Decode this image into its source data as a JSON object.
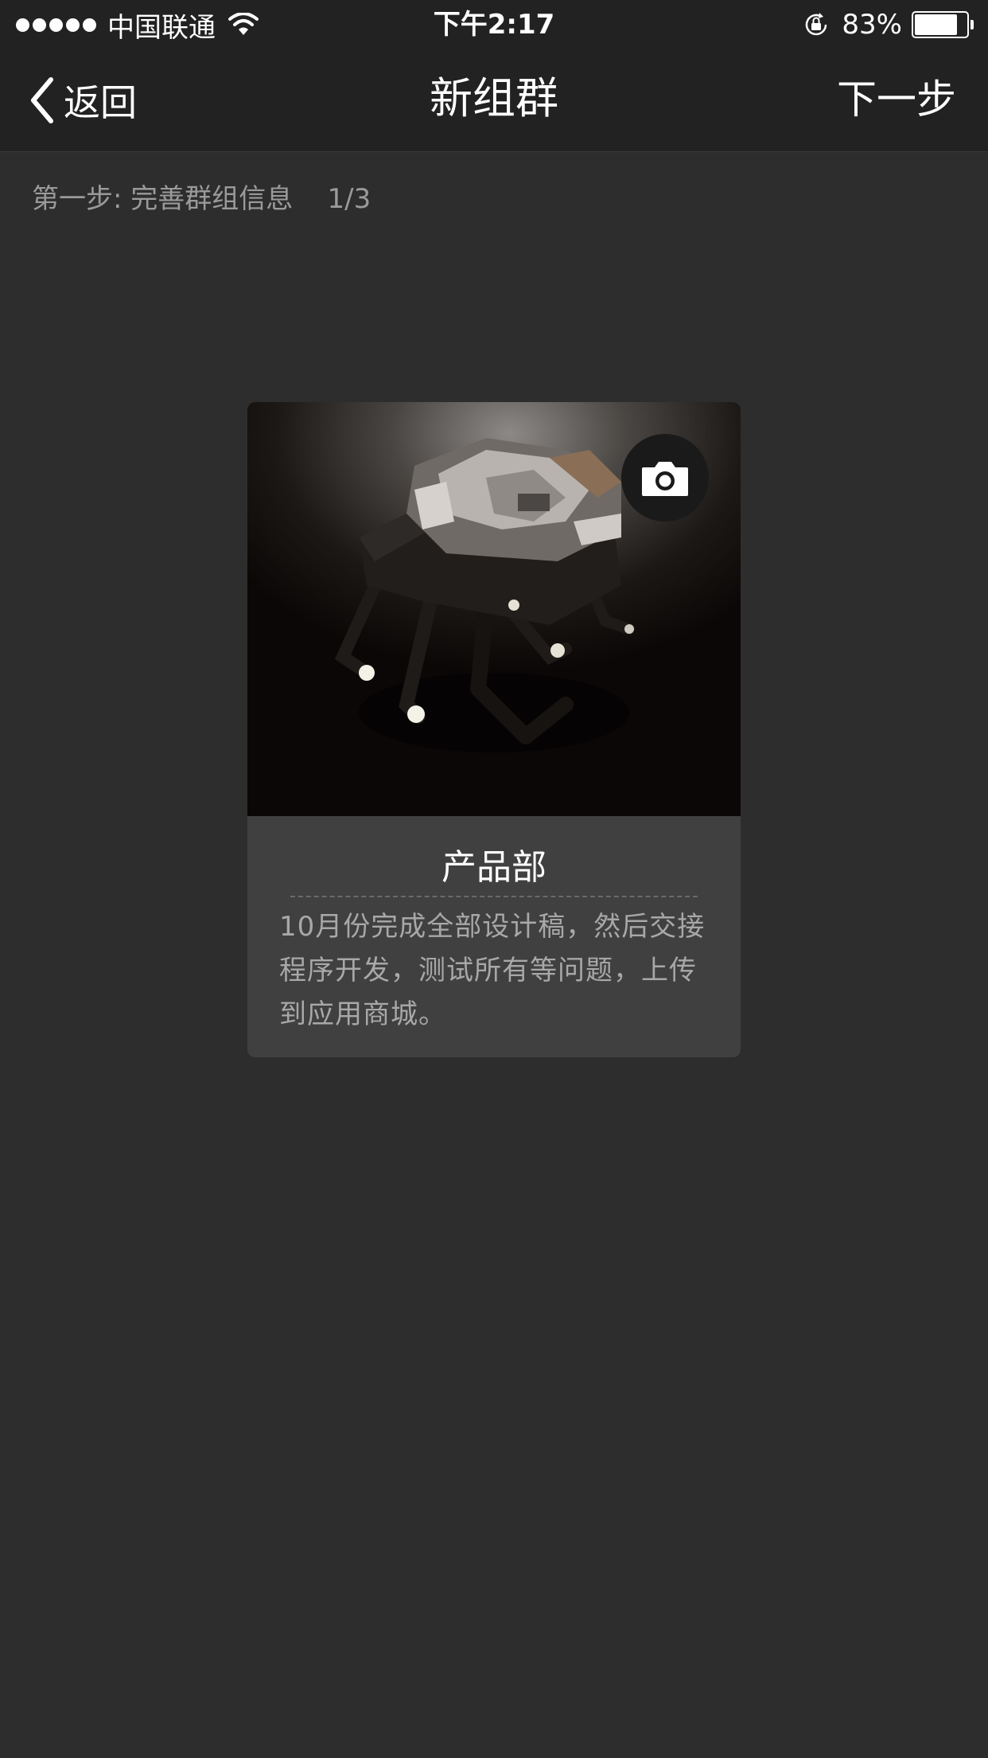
{
  "status_bar": {
    "carrier": "中国联通",
    "time": "下午2:17",
    "battery_percent": "83%",
    "battery_level": 0.83
  },
  "nav": {
    "back_label": "返回",
    "title": "新组群",
    "next_label": "下一步"
  },
  "step": {
    "label": "第一步: 完善群组信息",
    "progress": "1/3"
  },
  "card": {
    "title": "产品部",
    "description": "10月份完成全部设计稿，然后交接程序开发，测试所有等问题，上传到应用商城。",
    "camera_icon": "camera-icon"
  },
  "colors": {
    "background": "#2d2d2d",
    "bar": "#222222",
    "card": "#404040",
    "muted_text": "#9a9a9a"
  }
}
